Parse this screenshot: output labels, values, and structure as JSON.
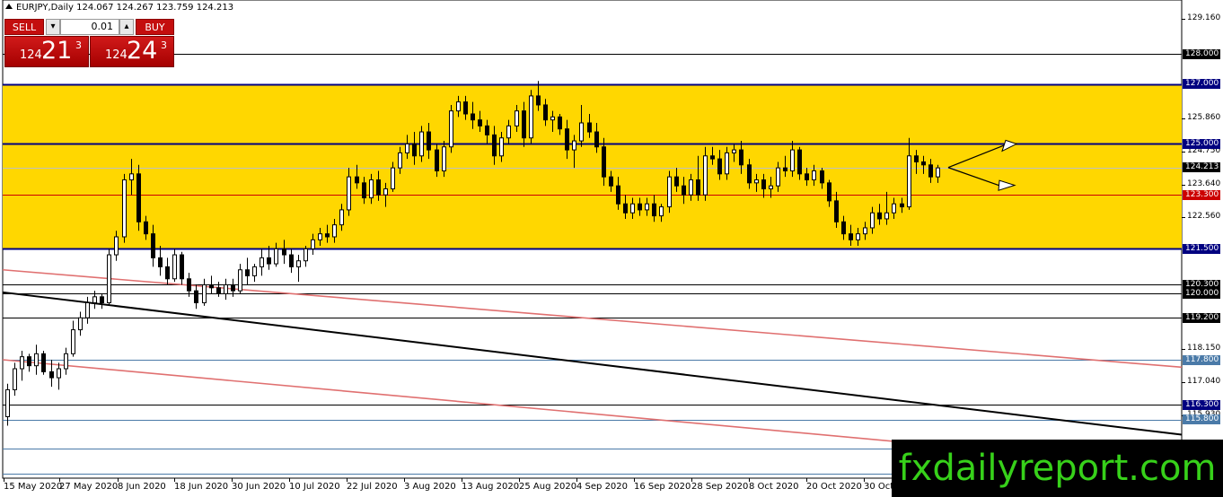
{
  "header": {
    "symbol_line": "EURJPY,Daily  124.067 124.267 123.759 124.213"
  },
  "trade_panel": {
    "sell_label": "SELL",
    "buy_label": "BUY",
    "lot_value": "0.01",
    "down_arrow": "▾",
    "up_arrow": "▴",
    "bid_prefix": "124",
    "bid_big": "21",
    "bid_sup": "3",
    "ask_prefix": "124",
    "ask_big": "24",
    "ask_sup": "3"
  },
  "watermark": "fxdailyreport.com",
  "colors": {
    "zone": "#ffd700",
    "blue_level": "#000080",
    "red_level": "#cc0000",
    "channel": "#e07070",
    "trend": "#000000",
    "thin_level": "#4a7aa8"
  },
  "chart_data": {
    "type": "candlestick",
    "symbol": "EURJPY",
    "timeframe": "Daily",
    "ylim": [
      113.85,
      129.8
    ],
    "x_tick_labels": [
      "15 May 2020",
      "27 May 2020",
      "8 Jun 2020",
      "18 Jun 2020",
      "30 Jun 2020",
      "10 Jul 2020",
      "22 Jul 2020",
      "3 Aug 2020",
      "13 Aug 2020",
      "25 Aug 2020",
      "4 Sep 2020",
      "16 Sep 2020",
      "28 Sep 2020",
      "8 Oct 2020",
      "20 Oct 2020",
      "30 Oct"
    ],
    "price_ticks": [
      "129.160",
      "125.860",
      "124.750",
      "123.640",
      "122.560",
      "118.150",
      "117.040",
      "115.930"
    ],
    "zone": {
      "from": 121.5,
      "to": 127.0
    },
    "levels": [
      {
        "price": 128.0,
        "label": "128.000",
        "color": "#000000",
        "label_bg": "#000000",
        "label_fg": "#ffffff"
      },
      {
        "price": 127.0,
        "label": "127.000",
        "color": "#000080",
        "label_bg": "#000080",
        "label_fg": "#ffffff"
      },
      {
        "price": 125.0,
        "label": "125.000",
        "color": "#000080",
        "label_bg": "#000080",
        "label_fg": "#ffffff"
      },
      {
        "price": 124.213,
        "label": "124.213",
        "color": "#c0c0c0",
        "label_bg": "#000000",
        "label_fg": "#ffffff"
      },
      {
        "price": 123.3,
        "label": "123.300",
        "color": "#cc0000",
        "label_bg": "#cc0000",
        "label_fg": "#ffffff"
      },
      {
        "price": 121.5,
        "label": "121.500",
        "color": "#000080",
        "label_bg": "#000080",
        "label_fg": "#ffffff"
      },
      {
        "price": 120.3,
        "label": "120.300",
        "color": "#000000",
        "label_bg": "#000000",
        "label_fg": "#ffffff"
      },
      {
        "price": 120.0,
        "label": "120.000",
        "color": "#000000",
        "label_bg": "#000000",
        "label_fg": "#ffffff"
      },
      {
        "price": 119.2,
        "label": "119.200",
        "color": "#000000",
        "label_bg": "#000000",
        "label_fg": "#ffffff"
      },
      {
        "price": 117.8,
        "label": "117.800",
        "color": "#4a7aa8",
        "label_bg": "#4a7aa8",
        "label_fg": "#ffffff"
      },
      {
        "price": 116.3,
        "label": "116.300",
        "color": "#000000",
        "label_bg": "#000080",
        "label_fg": "#ffffff"
      },
      {
        "price": 115.8,
        "label": "115.800",
        "color": "#4a7aa8",
        "label_bg": "#4a7aa8",
        "label_fg": "#ffffff"
      },
      {
        "price": 114.825,
        "label": "114.825",
        "color": "#4a7aa8",
        "label_bg": "#4a7aa8",
        "label_fg": "#ffffff"
      },
      {
        "price": 114.0,
        "label": "114.000",
        "color": "#4a7aa8",
        "label_bg": "#4a7aa8",
        "label_fg": "#ffffff"
      }
    ],
    "candles": [
      [
        115.9,
        117.0,
        115.6,
        116.8
      ],
      [
        116.8,
        117.7,
        116.6,
        117.5
      ],
      [
        117.5,
        118.1,
        117.1,
        117.9
      ],
      [
        117.9,
        118.0,
        117.4,
        117.6
      ],
      [
        117.6,
        118.3,
        117.3,
        118.0
      ],
      [
        118.0,
        118.1,
        117.3,
        117.4
      ],
      [
        117.4,
        117.8,
        116.9,
        117.2
      ],
      [
        117.2,
        117.7,
        116.8,
        117.5
      ],
      [
        117.5,
        118.2,
        117.3,
        118.0
      ],
      [
        118.0,
        119.1,
        117.9,
        118.8
      ],
      [
        118.8,
        119.4,
        118.6,
        119.2
      ],
      [
        119.2,
        119.9,
        119.0,
        119.7
      ],
      [
        119.7,
        120.1,
        119.5,
        119.9
      ],
      [
        119.9,
        120.0,
        119.5,
        119.7
      ],
      [
        119.7,
        121.5,
        119.6,
        121.3
      ],
      [
        121.3,
        122.1,
        121.1,
        121.9
      ],
      [
        121.9,
        124.0,
        121.7,
        123.8
      ],
      [
        123.8,
        124.5,
        123.3,
        124.0
      ],
      [
        124.0,
        124.3,
        122.1,
        122.4
      ],
      [
        122.4,
        122.6,
        121.8,
        122.0
      ],
      [
        122.0,
        122.3,
        120.9,
        121.2
      ],
      [
        121.2,
        121.6,
        120.6,
        120.9
      ],
      [
        120.9,
        121.2,
        120.3,
        120.5
      ],
      [
        120.5,
        121.5,
        120.4,
        121.3
      ],
      [
        121.3,
        121.4,
        120.3,
        120.5
      ],
      [
        120.5,
        120.7,
        119.9,
        120.1
      ],
      [
        120.1,
        120.3,
        119.5,
        119.7
      ],
      [
        119.7,
        120.5,
        119.6,
        120.3
      ],
      [
        120.3,
        120.6,
        120.0,
        120.2
      ],
      [
        120.2,
        120.4,
        119.9,
        120.0
      ],
      [
        120.0,
        120.5,
        119.8,
        120.3
      ],
      [
        120.3,
        120.5,
        119.9,
        120.1
      ],
      [
        120.1,
        121.0,
        120.0,
        120.8
      ],
      [
        120.8,
        121.2,
        120.3,
        120.6
      ],
      [
        120.6,
        121.0,
        120.4,
        120.9
      ],
      [
        120.9,
        121.5,
        120.6,
        121.2
      ],
      [
        121.2,
        121.6,
        120.8,
        121.0
      ],
      [
        121.0,
        121.7,
        120.9,
        121.5
      ],
      [
        121.5,
        121.8,
        121.0,
        121.3
      ],
      [
        121.3,
        121.5,
        120.7,
        120.9
      ],
      [
        120.9,
        121.3,
        120.4,
        121.1
      ],
      [
        121.1,
        121.6,
        120.9,
        121.5
      ],
      [
        121.5,
        122.0,
        121.3,
        121.8
      ],
      [
        121.8,
        122.2,
        121.6,
        122.0
      ],
      [
        122.0,
        122.3,
        121.7,
        121.9
      ],
      [
        121.9,
        122.5,
        121.7,
        122.3
      ],
      [
        122.3,
        123.0,
        122.1,
        122.8
      ],
      [
        122.8,
        124.2,
        122.6,
        123.9
      ],
      [
        123.9,
        124.3,
        123.5,
        123.7
      ],
      [
        123.7,
        123.9,
        123.0,
        123.2
      ],
      [
        123.2,
        124.0,
        123.0,
        123.8
      ],
      [
        123.8,
        124.1,
        123.1,
        123.3
      ],
      [
        123.3,
        123.7,
        122.9,
        123.5
      ],
      [
        123.5,
        124.4,
        123.4,
        124.2
      ],
      [
        124.2,
        124.9,
        124.0,
        124.7
      ],
      [
        124.7,
        125.3,
        124.5,
        125.0
      ],
      [
        125.0,
        125.4,
        124.3,
        124.6
      ],
      [
        124.6,
        125.6,
        124.4,
        125.4
      ],
      [
        125.4,
        125.7,
        124.5,
        124.8
      ],
      [
        124.8,
        125.0,
        123.9,
        124.1
      ],
      [
        124.1,
        125.1,
        123.9,
        124.9
      ],
      [
        124.9,
        126.3,
        124.7,
        126.1
      ],
      [
        126.1,
        126.6,
        125.9,
        126.4
      ],
      [
        126.4,
        126.6,
        125.8,
        126.0
      ],
      [
        126.0,
        126.4,
        125.5,
        125.8
      ],
      [
        125.8,
        126.1,
        125.4,
        125.6
      ],
      [
        125.6,
        125.8,
        125.0,
        125.3
      ],
      [
        125.3,
        125.6,
        124.3,
        124.6
      ],
      [
        124.6,
        125.4,
        124.4,
        125.2
      ],
      [
        125.2,
        125.8,
        125.0,
        125.6
      ],
      [
        125.6,
        126.3,
        125.4,
        126.1
      ],
      [
        126.1,
        126.4,
        124.9,
        125.2
      ],
      [
        125.2,
        126.8,
        125.0,
        126.6
      ],
      [
        126.6,
        127.1,
        126.1,
        126.3
      ],
      [
        126.3,
        126.5,
        125.6,
        125.8
      ],
      [
        125.8,
        126.1,
        125.4,
        125.9
      ],
      [
        125.9,
        126.0,
        125.3,
        125.5
      ],
      [
        125.5,
        125.8,
        124.5,
        124.8
      ],
      [
        124.8,
        125.3,
        124.2,
        125.1
      ],
      [
        125.1,
        126.3,
        124.9,
        125.7
      ],
      [
        125.7,
        126.0,
        125.2,
        125.4
      ],
      [
        125.4,
        125.7,
        124.7,
        124.9
      ],
      [
        124.9,
        125.2,
        123.6,
        123.9
      ],
      [
        123.9,
        124.1,
        123.4,
        123.6
      ],
      [
        123.6,
        123.9,
        122.8,
        123.0
      ],
      [
        123.0,
        123.3,
        122.5,
        122.7
      ],
      [
        122.7,
        123.2,
        122.5,
        123.0
      ],
      [
        123.0,
        123.2,
        122.6,
        122.8
      ],
      [
        122.8,
        123.2,
        122.6,
        123.0
      ],
      [
        123.0,
        123.3,
        122.4,
        122.6
      ],
      [
        122.6,
        123.0,
        122.4,
        122.9
      ],
      [
        122.9,
        124.1,
        122.7,
        123.9
      ],
      [
        123.9,
        124.2,
        123.4,
        123.6
      ],
      [
        123.6,
        123.9,
        123.0,
        123.3
      ],
      [
        123.3,
        124.0,
        123.1,
        123.8
      ],
      [
        123.8,
        124.6,
        123.1,
        123.3
      ],
      [
        123.3,
        124.9,
        123.1,
        124.6
      ],
      [
        124.6,
        124.9,
        124.3,
        124.5
      ],
      [
        124.5,
        124.8,
        123.8,
        124.0
      ],
      [
        124.0,
        124.9,
        123.8,
        124.7
      ],
      [
        124.7,
        125.0,
        124.4,
        124.8
      ],
      [
        124.8,
        125.1,
        124.0,
        124.3
      ],
      [
        124.3,
        124.5,
        123.5,
        123.7
      ],
      [
        123.7,
        124.0,
        123.4,
        123.8
      ],
      [
        123.8,
        124.0,
        123.2,
        123.5
      ],
      [
        123.5,
        123.9,
        123.2,
        123.6
      ],
      [
        123.6,
        124.4,
        123.4,
        124.2
      ],
      [
        124.2,
        124.6,
        123.9,
        124.1
      ],
      [
        124.1,
        125.1,
        123.9,
        124.8
      ],
      [
        124.8,
        124.9,
        123.8,
        124.0
      ],
      [
        124.0,
        124.2,
        123.6,
        123.8
      ],
      [
        123.8,
        124.3,
        123.6,
        124.1
      ],
      [
        124.1,
        124.2,
        123.5,
        123.7
      ],
      [
        123.7,
        123.8,
        122.9,
        123.1
      ],
      [
        123.1,
        123.4,
        122.2,
        122.4
      ],
      [
        122.4,
        122.6,
        121.8,
        122.0
      ],
      [
        122.0,
        122.3,
        121.6,
        121.8
      ],
      [
        121.8,
        122.2,
        121.6,
        122.0
      ],
      [
        122.0,
        122.4,
        121.8,
        122.2
      ],
      [
        122.2,
        122.9,
        122.0,
        122.7
      ],
      [
        122.7,
        123.0,
        122.3,
        122.5
      ],
      [
        122.5,
        123.4,
        122.3,
        122.7
      ],
      [
        122.7,
        123.2,
        122.5,
        123.0
      ],
      [
        123.0,
        123.2,
        122.7,
        122.9
      ],
      [
        122.9,
        125.2,
        122.8,
        124.6
      ],
      [
        124.6,
        124.8,
        124.0,
        124.4
      ],
      [
        124.4,
        124.6,
        124.0,
        124.3
      ],
      [
        124.3,
        124.5,
        123.7,
        123.9
      ],
      [
        123.9,
        124.3,
        123.7,
        124.2
      ]
    ],
    "trendlines": [
      {
        "name": "",
        "color": "#000000",
        "from": [
          0,
          120.05
        ],
        "to": [
          1,
          115.3
        ]
      },
      {
        "name": "",
        "color": "#e07070",
        "from": [
          0,
          120.8
        ],
        "to": [
          1,
          117.55
        ]
      },
      {
        "name": "",
        "color": "#e07070",
        "from": [
          0,
          117.8
        ],
        "to": [
          1,
          114.2
        ]
      }
    ]
  }
}
